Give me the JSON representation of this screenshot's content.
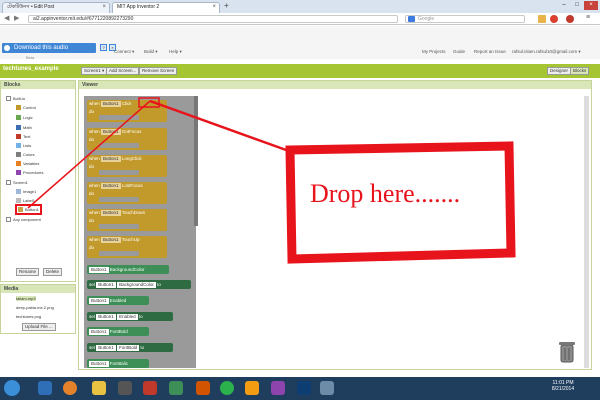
{
  "browser": {
    "tabs": [
      {
        "label": "টেকটিউনস • Edit Post"
      },
      {
        "label": "MIT App Inventor 2"
      }
    ],
    "url": "ai2.appinventor.mit.edu/#6771220892273290",
    "search_placeholder": "Google"
  },
  "header": {
    "download_label": "Download this audio",
    "beta": "Beta",
    "menu": [
      "Connect ▾",
      "Build ▾",
      "Help ▾"
    ],
    "right_links": [
      "My Projects",
      "Guide",
      "Report an Issue",
      "rafsul.islam.rafsul10@gmail.com ▾"
    ]
  },
  "project": {
    "name": "techtunes_example",
    "screen_button": "Screen1 ▾",
    "add_screen": "Add Screen...",
    "remove_screen": "Remove Screen",
    "designer": "Designer",
    "blocks": "Blocks"
  },
  "blocks_panel": {
    "title": "Blocks",
    "builtin": "Built-in",
    "builtin_items": [
      {
        "label": "Control",
        "color": "#c29a2c"
      },
      {
        "label": "Logic",
        "color": "#6aa84f"
      },
      {
        "label": "Math",
        "color": "#3d6fb6"
      },
      {
        "label": "Text",
        "color": "#c0392b"
      },
      {
        "label": "Lists",
        "color": "#74b1e6"
      },
      {
        "label": "Colors",
        "color": "#7f7f7f"
      },
      {
        "label": "Variables",
        "color": "#e67e22"
      },
      {
        "label": "Procedures",
        "color": "#8e44ad"
      }
    ],
    "screen": "Screen1",
    "components": [
      "Image1",
      "Label1",
      "Button1"
    ],
    "any": "Any component",
    "rename": "Rename",
    "delete": "Delete"
  },
  "media_panel": {
    "title": "Media",
    "files": [
      "tailam.mp3",
      "deep-pabla.me.2.png",
      "techtunes.png"
    ],
    "upload": "Upload File ..."
  },
  "viewer": {
    "title": "Viewer",
    "events": [
      {
        "when": "when",
        "component": "Button1",
        "event": "Click",
        "do": "do"
      },
      {
        "when": "when",
        "component": "Button1",
        "event": "GotFocus",
        "do": "do"
      },
      {
        "when": "when",
        "component": "Button1",
        "event": "LongClick",
        "do": "do"
      },
      {
        "when": "when",
        "component": "Button1",
        "event": "LostFocus",
        "do": "do"
      },
      {
        "when": "when",
        "component": "Button1",
        "event": "TouchDown",
        "do": "do"
      },
      {
        "when": "when",
        "component": "Button1",
        "event": "TouchUp",
        "do": "do"
      }
    ],
    "props": [
      {
        "prefix": "",
        "component": "Button1",
        "prop": "BackgroundColor",
        "suffix": "",
        "color": "#3e8f57"
      },
      {
        "prefix": "set",
        "component": "Button1",
        "prop": "BackgroundColor",
        "suffix": "to",
        "color": "#2f6b42"
      },
      {
        "prefix": "",
        "component": "Button1",
        "prop": "Enabled",
        "suffix": "",
        "color": "#3e8f57"
      },
      {
        "prefix": "set",
        "component": "Button1",
        "prop": "Enabled",
        "suffix": "to",
        "color": "#2f6b42"
      },
      {
        "prefix": "",
        "component": "Button1",
        "prop": "FontBold",
        "suffix": "",
        "color": "#3e8f57"
      },
      {
        "prefix": "set",
        "component": "Button1",
        "prop": "FontBold",
        "suffix": "to",
        "color": "#2f6b42"
      },
      {
        "prefix": "",
        "component": "Button1",
        "prop": "FontItalic",
        "suffix": "",
        "color": "#3e8f57"
      }
    ],
    "annotation": "Drop here......."
  },
  "taskbar": {
    "time": "11:01 PM",
    "date": "8/21/2014"
  },
  "colors": {
    "accent_green": "#a6c532",
    "annotation_red": "#e8141c",
    "event_block": "#c29a2c"
  }
}
